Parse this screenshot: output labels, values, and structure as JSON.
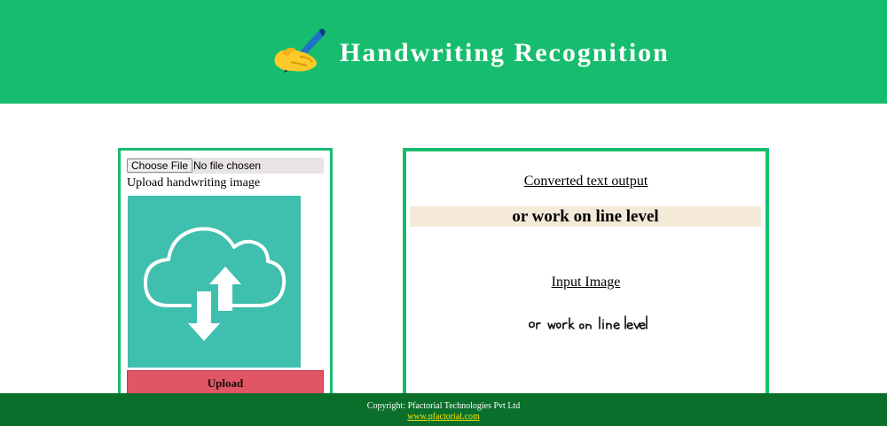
{
  "colors": {
    "header_bg": "#17bd6e",
    "panel_border": "#17bd6e",
    "illustration_bg": "#3fbfae",
    "upload_button_bg": "#e25565",
    "output_band_bg": "#f5e9d8",
    "footer_bg": "#0a6f2b",
    "footer_link": "#ffe600"
  },
  "header": {
    "logo_icon": "writing-hand-icon",
    "title": "Handwriting Recognition"
  },
  "upload_panel": {
    "choose_file_label": "Choose File",
    "file_status": "No file chosen",
    "instruction": "Upload handwriting image",
    "illustration_icon": "cloud-upload-download-icon",
    "upload_button_label": "Upload"
  },
  "result_panel": {
    "converted_heading": "Converted text output",
    "converted_text": "or work on line level",
    "input_heading": "Input Image",
    "input_image_icon": "handwriting-sample-image"
  },
  "footer": {
    "copyright": "Copyright: Pfactorial Technologies Pvt Ltd",
    "link_text": "www.pfactorial.com"
  }
}
